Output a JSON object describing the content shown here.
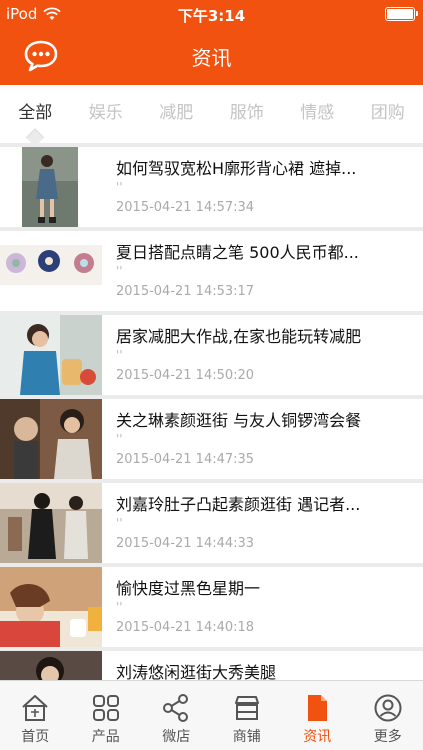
{
  "status_bar": {
    "carrier": "iPod",
    "time": "下午3:14"
  },
  "header": {
    "title": "资讯",
    "icon": "chat-bubble-icon"
  },
  "tabs": [
    {
      "label": "全部",
      "active": true
    },
    {
      "label": "娱乐"
    },
    {
      "label": "减肥"
    },
    {
      "label": "服饰"
    },
    {
      "label": "情感"
    },
    {
      "label": "团购"
    }
  ],
  "articles": [
    {
      "title": "如何驾驭宽松H廓形背心裙 遮掉...",
      "sub": "''",
      "date": "2015-04-21 14:57:34"
    },
    {
      "title": "夏日搭配点睛之笔 500人民币都...",
      "sub": "''",
      "date": "2015-04-21 14:53:17"
    },
    {
      "title": "居家减肥大作战,在家也能玩转减肥",
      "sub": "''",
      "date": "2015-04-21 14:50:20"
    },
    {
      "title": "关之琳素颜逛街 与友人铜锣湾会餐",
      "sub": "''",
      "date": "2015-04-21 14:47:35"
    },
    {
      "title": "刘嘉玲肚子凸起素颜逛街 遇记者...",
      "sub": "''",
      "date": "2015-04-21 14:44:33"
    },
    {
      "title": "愉快度过黑色星期一",
      "sub": "''",
      "date": "2015-04-21 14:40:18"
    },
    {
      "title": "刘涛悠闲逛街大秀美腿",
      "sub": "''",
      "date": ""
    }
  ],
  "tabbar": [
    {
      "label": "首页",
      "icon": "home-icon"
    },
    {
      "label": "产品",
      "icon": "grid-icon"
    },
    {
      "label": "微店",
      "icon": "share-icon"
    },
    {
      "label": "商铺",
      "icon": "shop-icon"
    },
    {
      "label": "资讯",
      "icon": "document-icon",
      "active": true
    },
    {
      "label": "更多",
      "icon": "user-icon"
    }
  ],
  "colors": {
    "brand": "#f2520f",
    "background": "#ebebeb"
  }
}
